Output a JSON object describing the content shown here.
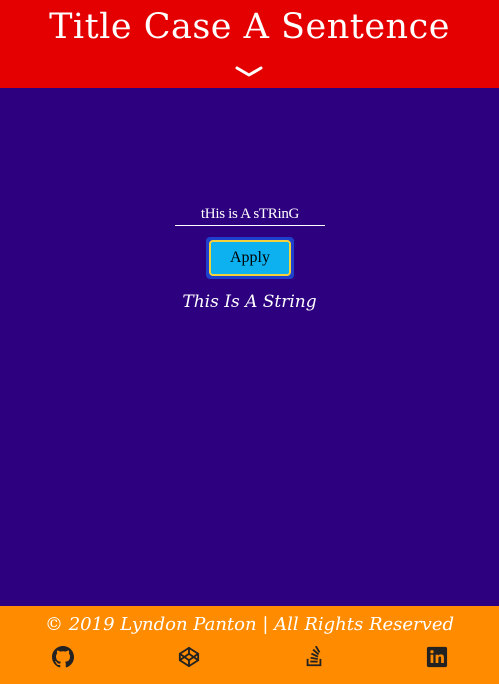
{
  "header": {
    "title": "Title Case A Sentence",
    "scroll_icon": "chevron-down-icon"
  },
  "main": {
    "input": {
      "value": "tHis is A sTRinG"
    },
    "apply_label": "Apply",
    "result": "This Is A String"
  },
  "footer": {
    "copyright": "© 2019 Lyndon Panton | All Rights Reserved",
    "links": [
      {
        "icon": "github-icon"
      },
      {
        "icon": "codepen-icon"
      },
      {
        "icon": "stack-overflow-icon"
      },
      {
        "icon": "linkedin-icon"
      }
    ]
  },
  "colors": {
    "header_bg": "#e40000",
    "main_bg": "#2c007e",
    "footer_bg": "#ff8c00",
    "button_bg": "#0db1ef",
    "button_border": "#f6d23a"
  }
}
